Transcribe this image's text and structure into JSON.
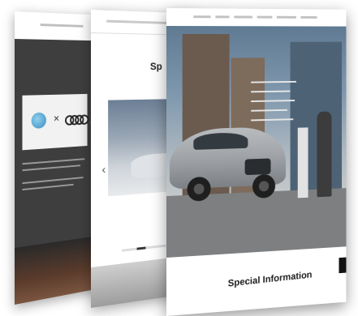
{
  "back_page": {
    "collab_times": "×"
  },
  "middle_page": {
    "title_partial": "Sp",
    "nav_arrow": "‹"
  },
  "front_page": {
    "hero_caption": "",
    "section_title": "Special Information"
  },
  "icons": [
    "audi-rings-icon",
    "globe-icon",
    "chevron-left-icon"
  ]
}
